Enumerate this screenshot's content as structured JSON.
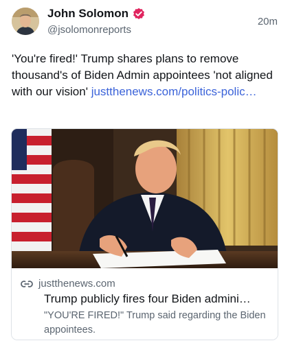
{
  "author": {
    "name": "John Solomon",
    "handle": "@jsolomonreports",
    "verified_badge_icon": "verified-check-icon",
    "badge_color": "#e0245e"
  },
  "post": {
    "time": "20m",
    "text": "'You're fired!' Trump shares plans to remove thousand's of Biden Admin appointees 'not aligned with our vision' ",
    "link_text": "justthenews.com/politics-polic…",
    "link_color": "#3b63d9"
  },
  "card": {
    "link_icon": "link-icon",
    "domain": "justthenews.com",
    "title": "Trump publicly fires four Biden admini…",
    "description": "\"YOU'RE FIRED!\" Trump said regarding the Biden appointees."
  }
}
